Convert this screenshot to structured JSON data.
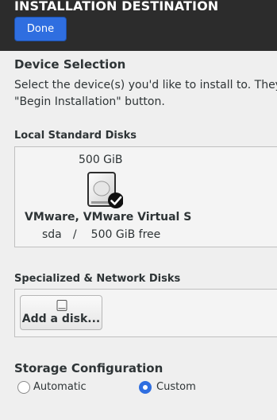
{
  "header": {
    "title": "INSTALLATION DESTINATION",
    "done_label": "Done"
  },
  "device_selection": {
    "title": "Device Selection",
    "description_line1": "Select the device(s) you'd like to install to.  They",
    "description_line2": "\"Begin Installation\" button."
  },
  "local_disks": {
    "title": "Local Standard Disks",
    "disks": [
      {
        "size": "500 GiB",
        "name": "VMware, VMware Virtual S",
        "device": "sda",
        "separator": "/",
        "free": "500 GiB free",
        "selected": true,
        "icon": "hard-disk-icon"
      }
    ]
  },
  "network_disks": {
    "title": "Specialized & Network Disks",
    "add_label": "Add a disk...",
    "add_icon": "disk-icon"
  },
  "storage_config": {
    "title": "Storage Configuration",
    "options": [
      {
        "label": "Automatic",
        "selected": false
      },
      {
        "label": "Custom",
        "selected": true
      }
    ]
  },
  "colors": {
    "header_bg": "#2c2c2c",
    "accent": "#2f6ee0",
    "page_bg": "#efefef"
  }
}
